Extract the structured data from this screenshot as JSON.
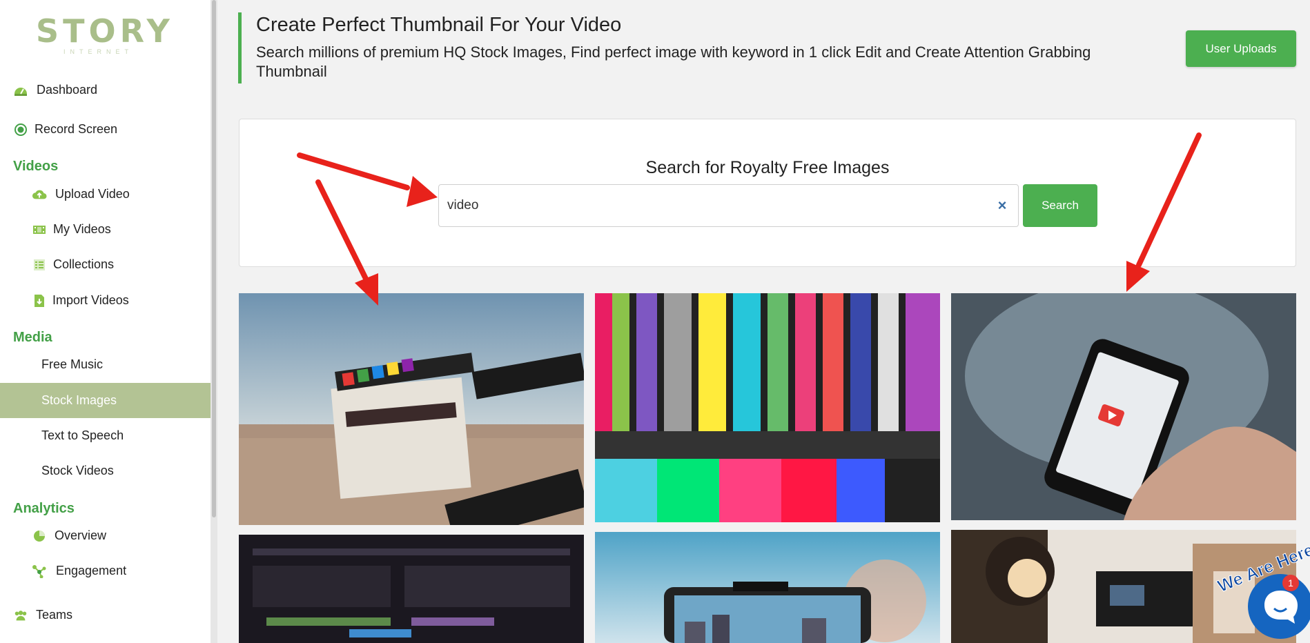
{
  "brand": {
    "logo": "STORY",
    "logo_sub": "INTERNET"
  },
  "sidebar": {
    "items_top": [
      {
        "label": "Dashboard",
        "icon": "dashboard-icon"
      },
      {
        "label": "Record Screen",
        "icon": "record-icon"
      }
    ],
    "sections": [
      {
        "title": "Videos",
        "items": [
          {
            "label": "Upload Video",
            "icon": "cloud-upload-icon"
          },
          {
            "label": "My Videos",
            "icon": "film-icon"
          },
          {
            "label": "Collections",
            "icon": "list-icon"
          },
          {
            "label": "Import Videos",
            "icon": "import-file-icon"
          }
        ]
      },
      {
        "title": "Media",
        "items": [
          {
            "label": "Free Music",
            "active": false
          },
          {
            "label": "Stock Images",
            "active": true
          },
          {
            "label": "Text to Speech",
            "active": false
          },
          {
            "label": "Stock Videos",
            "active": false
          }
        ]
      },
      {
        "title": "Analytics",
        "items": [
          {
            "label": "Overview",
            "icon": "pie-chart-icon"
          },
          {
            "label": "Engagement",
            "icon": "network-icon"
          }
        ]
      }
    ],
    "bottom": {
      "label": "Teams",
      "icon": "users-icon"
    }
  },
  "header": {
    "title": "Create Perfect Thumbnail For Your Video",
    "description": "Search millions of premium HQ Stock Images, Find perfect image with keyword in 1 click Edit and Create Attention Grabbing Thumbnail",
    "user_uploads_label": "User Uploads"
  },
  "search": {
    "title": "Search for Royalty Free Images",
    "value": "video",
    "clear_label": "×",
    "button_label": "Search"
  },
  "images": [
    {
      "subject": "film clapperboard in desert"
    },
    {
      "subject": "color bars test pattern screen"
    },
    {
      "subject": "hand holding phone with video play icon"
    },
    {
      "subject": "video editing timeline on monitor"
    },
    {
      "subject": "phone on stand recording city"
    },
    {
      "subject": "camera with studio lights"
    }
  ],
  "chat": {
    "label": "We Are Here!",
    "badge": "1"
  },
  "colors": {
    "accent": "#4caf50",
    "sidebar_active": "#b3c394",
    "arrow": "#e8221b"
  }
}
